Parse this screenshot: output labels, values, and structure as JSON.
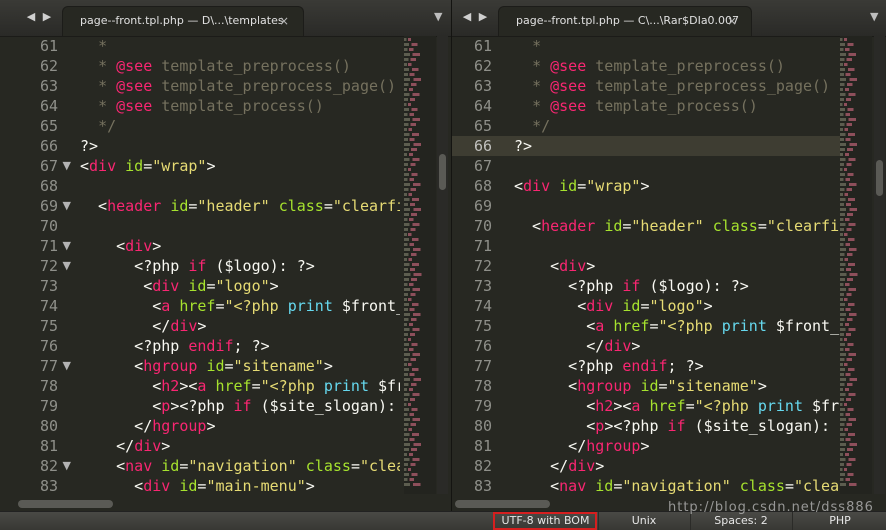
{
  "left": {
    "nav_back": "◀",
    "nav_forward": "▶",
    "tab_title": "page--front.tpl.php — D\\...\\templates",
    "tab_close": "×",
    "dropdown": "▼",
    "lines": [
      {
        "n": "61",
        "fold": false,
        "html": "  <span class='tok-comment'>*</span>"
      },
      {
        "n": "62",
        "fold": false,
        "html": "  <span class='tok-comment'>*</span> <span class='tok-tag'>@see</span> <span class='tok-comment'>template_preprocess()</span>"
      },
      {
        "n": "63",
        "fold": false,
        "html": "  <span class='tok-comment'>*</span> <span class='tok-tag'>@see</span> <span class='tok-comment'>template_preprocess_page()</span>"
      },
      {
        "n": "64",
        "fold": false,
        "html": "  <span class='tok-comment'>*</span> <span class='tok-tag'>@see</span> <span class='tok-comment'>template_process()</span>"
      },
      {
        "n": "65",
        "fold": false,
        "html": "  <span class='tok-comment'>*/</span>"
      },
      {
        "n": "66",
        "fold": false,
        "html": "?>"
      },
      {
        "n": "67",
        "fold": true,
        "html": "&lt;<span class='tok-tag'>div</span> <span class='tok-attr'>id</span>=<span class='tok-str'>\"wrap\"</span>>"
      },
      {
        "n": "68",
        "fold": false,
        "html": ""
      },
      {
        "n": "69",
        "fold": true,
        "html": "  &lt;<span class='tok-tag'>header</span> <span class='tok-attr'>id</span>=<span class='tok-str'>\"header\"</span> <span class='tok-attr'>class</span>=<span class='tok-str'>\"clearfi</span>"
      },
      {
        "n": "70",
        "fold": false,
        "html": ""
      },
      {
        "n": "71",
        "fold": true,
        "html": "    &lt;<span class='tok-tag'>div</span>>"
      },
      {
        "n": "72",
        "fold": true,
        "html": "      &lt;?php <span class='tok-kw'>if</span> (<span class='tok-var'>$logo</span>): ?>"
      },
      {
        "n": "73",
        "fold": false,
        "html": "       &lt;<span class='tok-tag'>div</span> <span class='tok-attr'>id</span>=<span class='tok-str'>\"logo\"</span>>"
      },
      {
        "n": "74",
        "fold": false,
        "html": "        &lt;<span class='tok-tag'>a</span> <span class='tok-attr'>href</span>=<span class='tok-str'>\"&lt;?php</span> <span class='tok-fn'>print</span> $front_"
      },
      {
        "n": "75",
        "fold": false,
        "html": "        &lt;/<span class='tok-tag'>div</span>>"
      },
      {
        "n": "76",
        "fold": false,
        "html": "      &lt;?php <span class='tok-kw'>endif</span>; ?>"
      },
      {
        "n": "77",
        "fold": true,
        "html": "      &lt;<span class='tok-tag'>hgroup</span> <span class='tok-attr'>id</span>=<span class='tok-str'>\"sitename\"</span>>"
      },
      {
        "n": "78",
        "fold": false,
        "html": "        &lt;<span class='tok-tag'>h2</span>>&lt;<span class='tok-tag'>a</span> <span class='tok-attr'>href</span>=<span class='tok-str'>\"&lt;?php</span> <span class='tok-fn'>print</span> $fr"
      },
      {
        "n": "79",
        "fold": false,
        "html": "        &lt;<span class='tok-tag'>p</span>>&lt;?php <span class='tok-kw'>if</span> ($site_slogan):"
      },
      {
        "n": "80",
        "fold": false,
        "html": "      &lt;/<span class='tok-tag'>hgroup</span>>"
      },
      {
        "n": "81",
        "fold": false,
        "html": "    &lt;/<span class='tok-tag'>div</span>>"
      },
      {
        "n": "82",
        "fold": true,
        "html": "    &lt;<span class='tok-tag'>nav</span> <span class='tok-attr'>id</span>=<span class='tok-str'>\"navigation\"</span> <span class='tok-attr'>class</span>=<span class='tok-str'>\"clea</span>"
      },
      {
        "n": "83",
        "fold": false,
        "html": "      &lt;<span class='tok-tag'>div</span> <span class='tok-attr'>id</span>=<span class='tok-str'>\"main-menu\"</span>>"
      }
    ]
  },
  "right": {
    "nav_back": "◀",
    "nav_forward": "▶",
    "tab_title": "page--front.tpl.php — C\\...\\Rar$DIa0.007",
    "tab_close": "×",
    "dropdown": "▼",
    "lines": [
      {
        "n": "61",
        "fold": false,
        "active": false,
        "html": "  <span class='tok-comment'>*</span>"
      },
      {
        "n": "62",
        "fold": false,
        "active": false,
        "html": "  <span class='tok-comment'>*</span> <span class='tok-tag'>@see</span> <span class='tok-comment'>template_preprocess()</span>"
      },
      {
        "n": "63",
        "fold": false,
        "active": false,
        "html": "  <span class='tok-comment'>*</span> <span class='tok-tag'>@see</span> <span class='tok-comment'>template_preprocess_page()</span>"
      },
      {
        "n": "64",
        "fold": false,
        "active": false,
        "html": "  <span class='tok-comment'>*</span> <span class='tok-tag'>@see</span> <span class='tok-comment'>template_process()</span>"
      },
      {
        "n": "65",
        "fold": false,
        "active": false,
        "html": "  <span class='tok-comment'>*/</span>"
      },
      {
        "n": "66",
        "fold": false,
        "active": true,
        "html": "?>"
      },
      {
        "n": "67",
        "fold": false,
        "active": false,
        "html": ""
      },
      {
        "n": "68",
        "fold": false,
        "active": false,
        "html": "&lt;<span class='tok-tag'>div</span> <span class='tok-attr'>id</span>=<span class='tok-str'>\"wrap\"</span>>"
      },
      {
        "n": "69",
        "fold": false,
        "active": false,
        "html": ""
      },
      {
        "n": "70",
        "fold": false,
        "active": false,
        "html": "  &lt;<span class='tok-tag'>header</span> <span class='tok-attr'>id</span>=<span class='tok-str'>\"header\"</span> <span class='tok-attr'>class</span>=<span class='tok-str'>\"clearfi</span>"
      },
      {
        "n": "71",
        "fold": false,
        "active": false,
        "html": ""
      },
      {
        "n": "72",
        "fold": false,
        "active": false,
        "html": "    &lt;<span class='tok-tag'>div</span>>"
      },
      {
        "n": "73",
        "fold": false,
        "active": false,
        "html": "      &lt;?php <span class='tok-kw'>if</span> (<span class='tok-var'>$logo</span>): ?>"
      },
      {
        "n": "74",
        "fold": false,
        "active": false,
        "html": "       &lt;<span class='tok-tag'>div</span> <span class='tok-attr'>id</span>=<span class='tok-str'>\"logo\"</span>>"
      },
      {
        "n": "75",
        "fold": false,
        "active": false,
        "html": "        &lt;<span class='tok-tag'>a</span> <span class='tok-attr'>href</span>=<span class='tok-str'>\"&lt;?php</span> <span class='tok-fn'>print</span> $front_"
      },
      {
        "n": "76",
        "fold": false,
        "active": false,
        "html": "        &lt;/<span class='tok-tag'>div</span>>"
      },
      {
        "n": "77",
        "fold": false,
        "active": false,
        "html": "      &lt;?php <span class='tok-kw'>endif</span>; ?>"
      },
      {
        "n": "78",
        "fold": false,
        "active": false,
        "html": "      &lt;<span class='tok-tag'>hgroup</span> <span class='tok-attr'>id</span>=<span class='tok-str'>\"sitename\"</span>>"
      },
      {
        "n": "79",
        "fold": false,
        "active": false,
        "html": "        &lt;<span class='tok-tag'>h2</span>>&lt;<span class='tok-tag'>a</span> <span class='tok-attr'>href</span>=<span class='tok-str'>\"&lt;?php</span> <span class='tok-fn'>print</span> $fr"
      },
      {
        "n": "80",
        "fold": false,
        "active": false,
        "html": "        &lt;<span class='tok-tag'>p</span>>&lt;?php <span class='tok-kw'>if</span> ($site_slogan):"
      },
      {
        "n": "81",
        "fold": false,
        "active": false,
        "html": "      &lt;/<span class='tok-tag'>hgroup</span>>"
      },
      {
        "n": "82",
        "fold": false,
        "active": false,
        "html": "    &lt;/<span class='tok-tag'>div</span>>"
      },
      {
        "n": "83",
        "fold": false,
        "active": false,
        "html": "    &lt;<span class='tok-tag'>nav</span> <span class='tok-attr'>id</span>=<span class='tok-str'>\"navigation\"</span> <span class='tok-attr'>class</span>=<span class='tok-str'>\"clea</span>"
      }
    ]
  },
  "statusbar": {
    "encoding": "UTF-8 with BOM",
    "line_endings": "Unix",
    "indentation": "Spaces: 2",
    "syntax": "PHP"
  },
  "watermark": "http://blog.csdn.net/dss886",
  "icons": {
    "back": "triangle-left-icon",
    "forward": "triangle-right-icon",
    "close": "close-icon",
    "dropdown": "chevron-down-icon",
    "fold": "fold-arrow-icon"
  },
  "colors": {
    "background": "#272822",
    "comment": "#75715e",
    "tag": "#f92672",
    "attribute": "#a6e22e",
    "string": "#e6db74",
    "function": "#66d9ef",
    "status_highlight": "#d51f1f"
  }
}
